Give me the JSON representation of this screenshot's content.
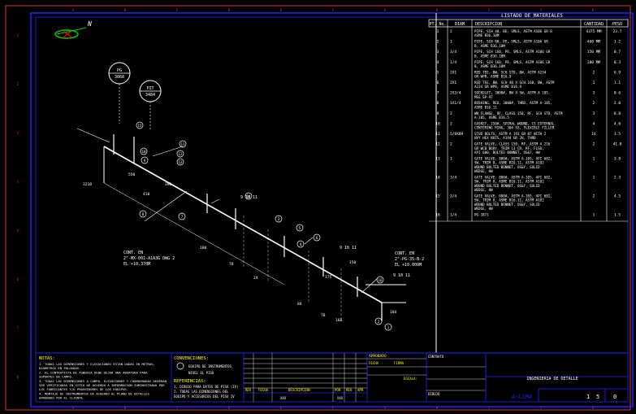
{
  "bom": {
    "title": "LISTADO DE MATERIALES",
    "headers": [
      "PT. No.",
      "DIAM",
      "DESCRIPCION",
      "CANTIDAD",
      "PESO"
    ],
    "rows": [
      {
        "pt": "1",
        "diam": "2",
        "desc": [
          "PIPE, SCH 40, BE, SMLS, ASTM A106 GR B",
          "ASME B36.10M"
        ],
        "qty": "4375 MM",
        "peso": "23.7"
      },
      {
        "pt": "2",
        "diam": "1",
        "desc": [
          "PIPE, SCH 80, PE, SMLS, ASTM A106 GR",
          "B, ASME B36.10M"
        ],
        "qty": "460 MM",
        "peso": "1.2"
      },
      {
        "pt": "3",
        "diam": "3/4",
        "desc": [
          "PIPE, SCH 160, PE, SMLS, ASTM A106 GR",
          "B, ASME B36.10M"
        ],
        "qty": "150 MM",
        "peso": "0.7"
      },
      {
        "pt": "4",
        "diam": "1/4",
        "desc": [
          "PIPE, SCH 160, PE, SMLS, ASTM A106 GR",
          "B, ASME B36.10M"
        ],
        "qty": "200 MM",
        "peso": "0.3"
      },
      {
        "pt": "5",
        "diam": "2X1",
        "desc": [
          "RED TEE, BW, SCH STD, BW, ASTM A234",
          "GR WPB, ASME B16.9"
        ],
        "qty": "2",
        "peso": "6.9"
      },
      {
        "pt": "6",
        "diam": "2X1",
        "desc": [
          "RED TEE, BW, SCH 40 X SCH 160, BW, ASTM",
          "A234 GR WPB, ASME B16.9"
        ],
        "qty": "1",
        "peso": "1.1"
      },
      {
        "pt": "7",
        "diam": "2X3/4",
        "desc": [
          "SOCKOLET, 3000#, BW X SW, ASTM A 105,",
          "MSS SP-97"
        ],
        "qty": "3",
        "peso": "0.6"
      },
      {
        "pt": "8",
        "diam": "1X1/4",
        "desc": [
          "BUSHING, RED, 3000#, THRD, ASTM A-105,",
          "ASME B16.11"
        ],
        "qty": "2",
        "peso": "2.0"
      },
      {
        "pt": "9",
        "diam": "2",
        "desc": [
          "WN FLANGE, RF, CLASS 150, RF, SCH STD, ASTM",
          "A-105, ASME B16.5"
        ],
        "qty": "3",
        "peso": "8.8"
      },
      {
        "pt": "10",
        "diam": "2",
        "desc": [
          "GASKET, 150#, SPIRAL WOUND, CS EXTERNAL",
          "CENTERING RING, 304 SS, FLEXIBLE FILLER"
        ],
        "qty": "4",
        "peso": "4.0"
      },
      {
        "pt": "11",
        "diam": "5/8X89",
        "desc": [
          "STUD BOLTS, ASTM A 193 GR B7 WITH 2",
          "HVY HEX NUTS, A194 GR 2H, THRD"
        ],
        "qty": "16",
        "peso": "3.5"
      },
      {
        "pt": "12",
        "diam": "2",
        "desc": [
          "GATE VALVE, CLASS 150, RF, ASTM A 216",
          "GR WCB BODY, TRIM 13 CR, RF, FLGD,",
          "API 600, BOLTED BONNET, OS&Y, HW"
        ],
        "qty": "2",
        "peso": "41.8"
      },
      {
        "pt": "13",
        "diam": "1",
        "desc": [
          "GATE VALVE, 800#, ASTM A-105, API 602,",
          "SW, TRIM 8, ASME B16.11, ASTM A182",
          "WOUND BOLTED BONNET, OS&Y, SOLID",
          "WEDGE, HW"
        ],
        "qty": "1",
        "peso": "3.8"
      },
      {
        "pt": "14",
        "diam": "3/4",
        "desc": [
          "GATE VALVE, 800#, ASTM A-105, API 602,",
          "SW, TRIM 8, ASME B16.11, ASTM A182",
          "WOUND BOLTED BONNET, OS&Y, SOLID",
          "WEDGE, HW"
        ],
        "qty": "1",
        "peso": "2.3"
      },
      {
        "pt": "15",
        "diam": "3/4",
        "desc": [
          "GATE VALVE, 800#, ASTM A-105, API 602,",
          "SW, TRIM 8, ASME B16.11, ASTM A182",
          "WOUND BOLTED BONNET, OS&Y, SOLID",
          "WEDGE, HW"
        ],
        "qty": "2",
        "peso": "4.5"
      },
      {
        "pt": "16",
        "diam": "1/4",
        "desc": [
          "PG-3871"
        ],
        "qty": "1",
        "peso": "1.5"
      }
    ]
  },
  "drawing": {
    "north": "N",
    "instrument_1": {
      "tag": "PG",
      "num": "3868"
    },
    "instrument_2": {
      "tag": "PIT",
      "num": "3484"
    },
    "cont_left": [
      "CONT. EN",
      "2\"-MX-001-A1A3G DWG 2",
      "EL +10.370M"
    ],
    "cont_right": [
      "CONT. EN",
      "2\"-PG-35-B-2",
      "EL +10.000M"
    ],
    "dimensions": [
      "3210",
      "410",
      "390",
      "550",
      "180",
      "78",
      "24",
      "84",
      "175",
      "160",
      "78",
      "184",
      "150"
    ],
    "balloons": [
      "15",
      "10",
      "9",
      "11",
      "12",
      "13",
      "14",
      "8",
      "7",
      "3",
      "5",
      "6",
      "4",
      "16",
      "2",
      "1"
    ],
    "labels": [
      "9 10 11",
      "9 10 11",
      "9 10 11"
    ]
  },
  "notes": {
    "title": "NOTAS:",
    "lines": [
      "1. TODAS LAS DIMENSIONES Y ELEVACIONES ESTAN DADAS EN METROS,",
      "   DIAMETROS EN PULGADAS.",
      "2. EL CONTRATISTA DE TUBERIA DEBE DEJAR UNA ABERTURA PARA",
      "   SOPORTES EN CAMPO.",
      "3. TODAS LAS DIMENSIONES A CAMPO, ELEVACIONES Y COORDENADAS DEBERAN",
      "   SER VERIFICADAS EN SITIO DE ACUERDO A INFORMACION SUMINISTRADA POR",
      "   LOS FABRICANTES Y/O PROVEEDORES DE LOS EQUIPOS.",
      "4. MONTAJE DE INSTRUMENTOS DE ACUERDO AL PLANO DE DETALLES",
      "   APROBADO POR EL CLIENTE."
    ]
  },
  "conventions": {
    "title": "CONVENCIONES:",
    "items": [
      "EQUIPO DE INSTRUMENTOS",
      "NIVEL EL PISO"
    ]
  },
  "references": {
    "title": "REFERENCIAS:",
    "lines": [
      "1. DIBUJO PARA DATOS DE PISO (IV)",
      "2. TODAS LAS DIMENSIONES DEL",
      "   EQUIPO Y ACCESORIOS DEL PISO IV"
    ]
  },
  "revision": {
    "headers": [
      "REV",
      "FECHA",
      "DESCRIPCION",
      "POR",
      "REV",
      "APR"
    ],
    "row": [
      "XXX",
      "XXX"
    ]
  },
  "approvals": {
    "title": "APROBADO",
    "fields": [
      "FECHA",
      "FIRMA",
      "ESCALA:",
      "CONTRATO",
      "DIBUJO"
    ]
  },
  "titleblock": {
    "main": "INGENIERIA DE DETALLE",
    "sheet": "1",
    "of": "5",
    "rev": "0",
    "logo": "A-LIMA"
  },
  "border_letters": [
    "A",
    "B",
    "C",
    "D",
    "E",
    "F",
    "G",
    "H",
    "I",
    "J",
    "K"
  ],
  "border_numbers": [
    "1",
    "2",
    "3",
    "4",
    "5",
    "6",
    "7",
    "8"
  ]
}
